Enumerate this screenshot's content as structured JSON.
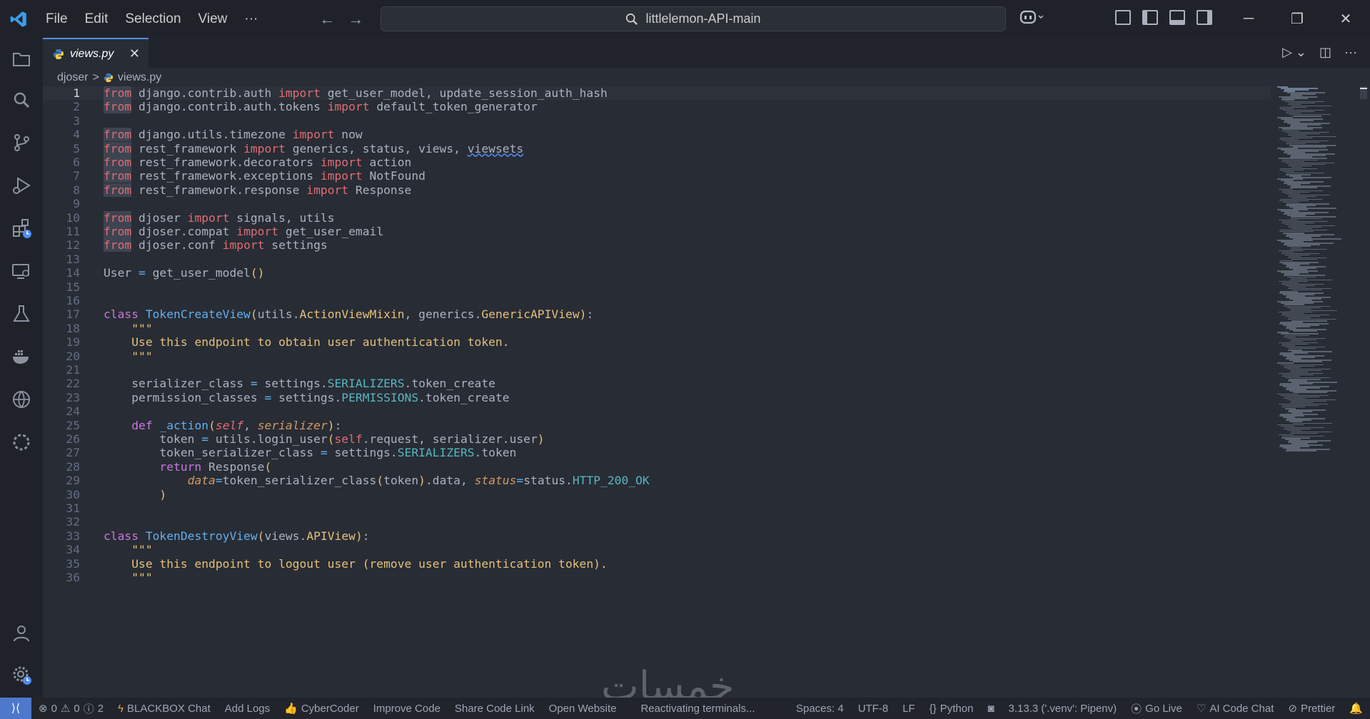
{
  "titlebar": {
    "menu": [
      "File",
      "Edit",
      "Selection",
      "View",
      "···"
    ],
    "search_text": "littlelemon-API-main",
    "window_controls": [
      "minimize",
      "restore",
      "close"
    ]
  },
  "tab": {
    "label": "views.py",
    "close": "✕"
  },
  "breadcrumb": {
    "folder": "djoser",
    "separator": ">",
    "file": "views.py"
  },
  "lines": [
    {
      "n": "1",
      "html": "<span class='fr'>from</span> django.contrib.auth <span class='im'>import</span> get_user_model, update_session_auth_hash"
    },
    {
      "n": "2",
      "html": "<span class='fr'>from</span> django.contrib.auth.tokens <span class='im'>import</span> default_token_generator"
    },
    {
      "n": "3",
      "html": ""
    },
    {
      "n": "4",
      "html": "<span class='fr'>from</span> django.utils.timezone <span class='im'>import</span> now"
    },
    {
      "n": "5",
      "html": "<span class='fr'>from</span> rest_framework <span class='im'>import</span> generics, status, views, <span class='wav'>viewsets</span>"
    },
    {
      "n": "6",
      "html": "<span class='fr'>from</span> rest_framework.decorators <span class='im'>import</span> action"
    },
    {
      "n": "7",
      "html": "<span class='fr'>from</span> rest_framework.exceptions <span class='im'>import</span> NotFound"
    },
    {
      "n": "8",
      "html": "<span class='fr'>from</span> rest_framework.response <span class='im'>import</span> Response"
    },
    {
      "n": "9",
      "html": ""
    },
    {
      "n": "10",
      "html": "<span class='fr'>from</span> djoser <span class='im'>import</span> signals, utils"
    },
    {
      "n": "11",
      "html": "<span class='fr'>from</span> djoser.compat <span class='im'>import</span> get_user_email"
    },
    {
      "n": "12",
      "html": "<span class='fr'>from</span> djoser.conf <span class='im'>import</span> settings"
    },
    {
      "n": "13",
      "html": ""
    },
    {
      "n": "14",
      "html": "User <span class='fn'>=</span> get_user_model<span class='yel'>()</span>"
    },
    {
      "n": "15",
      "html": ""
    },
    {
      "n": "16",
      "html": ""
    },
    {
      "n": "17",
      "html": "<span class='cl'>class</span> <span class='fn'>TokenCreateView</span><span class='yel'>(</span>utils.<span class='str'>ActionViewMixin</span>, generics.<span class='str'>GenericAPIView</span><span class='yel'>)</span>:"
    },
    {
      "n": "18",
      "html": "    <span class='str'>\"\"\"</span>"
    },
    {
      "n": "19",
      "html": "    <span class='str'>Use this endpoint to obtain user authentication token.</span>"
    },
    {
      "n": "20",
      "html": "    <span class='str'>\"\"\"</span>"
    },
    {
      "n": "21",
      "html": ""
    },
    {
      "n": "22",
      "html": "    serializer_class <span class='fn'>=</span> settings.<span class='const'>SERIALIZERS</span>.token_create"
    },
    {
      "n": "23",
      "html": "    permission_classes <span class='fn'>=</span> settings.<span class='const'>PERMISSIONS</span>.token_create"
    },
    {
      "n": "24",
      "html": ""
    },
    {
      "n": "25",
      "html": "    <span class='cl'>def</span> <span class='fn'>_action</span><span class='yel'>(</span><span class='sl'>self</span>, <span class='pm'>serializer</span><span class='yel'>)</span>:"
    },
    {
      "n": "26",
      "html": "        token <span class='fn'>=</span> utils.login_user<span class='yel'>(</span><span class='im'>self</span>.request, serializer.user<span class='yel'>)</span>"
    },
    {
      "n": "27",
      "html": "        token_serializer_class <span class='fn'>=</span> settings.<span class='const'>SERIALIZERS</span>.token"
    },
    {
      "n": "28",
      "html": "        <span class='cl'>return</span> Response<span class='yel'>(</span>"
    },
    {
      "n": "29",
      "html": "            <span class='pm'>data</span><span class='fn'>=</span>token_serializer_class<span class='yel'>(</span>token<span class='yel'>)</span>.data, <span class='pm'>status</span><span class='fn'>=</span>status.<span class='const'>HTTP_200_OK</span>"
    },
    {
      "n": "30",
      "html": "        <span class='yel'>)</span>"
    },
    {
      "n": "31",
      "html": ""
    },
    {
      "n": "32",
      "html": ""
    },
    {
      "n": "33",
      "html": "<span class='cl'>class</span> <span class='fn'>TokenDestroyView</span><span class='yel'>(</span>views.<span class='str'>APIView</span><span class='yel'>)</span>:"
    },
    {
      "n": "34",
      "html": "    <span class='str'>\"\"\"</span>"
    },
    {
      "n": "35",
      "html": "    <span class='str'>Use this endpoint to logout user (remove user authentication token).</span>"
    },
    {
      "n": "36",
      "html": "    <span class='str'>\"\"\"</span>"
    }
  ],
  "watermark": "خمسات",
  "status": {
    "errors": "0",
    "warnings": "0",
    "info": "2",
    "blackbox": "BLACKBOX Chat",
    "add_logs": "Add Logs",
    "cybercoder": "CyberCoder",
    "improve": "Improve Code",
    "share": "Share Code Link",
    "open_website": "Open Website",
    "reactivating": "Reactivating terminals...",
    "spaces": "Spaces: 4",
    "encoding": "UTF-8",
    "eol": "LF",
    "language": "Python",
    "interpreter": "3.13.3 ('.venv': Pipenv)",
    "golive": "Go Live",
    "aichat": "AI Code Chat",
    "prettier": "Prettier"
  },
  "colors": {
    "accent": "#528bff",
    "remote": "#4d78cc",
    "keyword": "#c678dd",
    "function": "#61afef",
    "string": "#e5c07b"
  }
}
